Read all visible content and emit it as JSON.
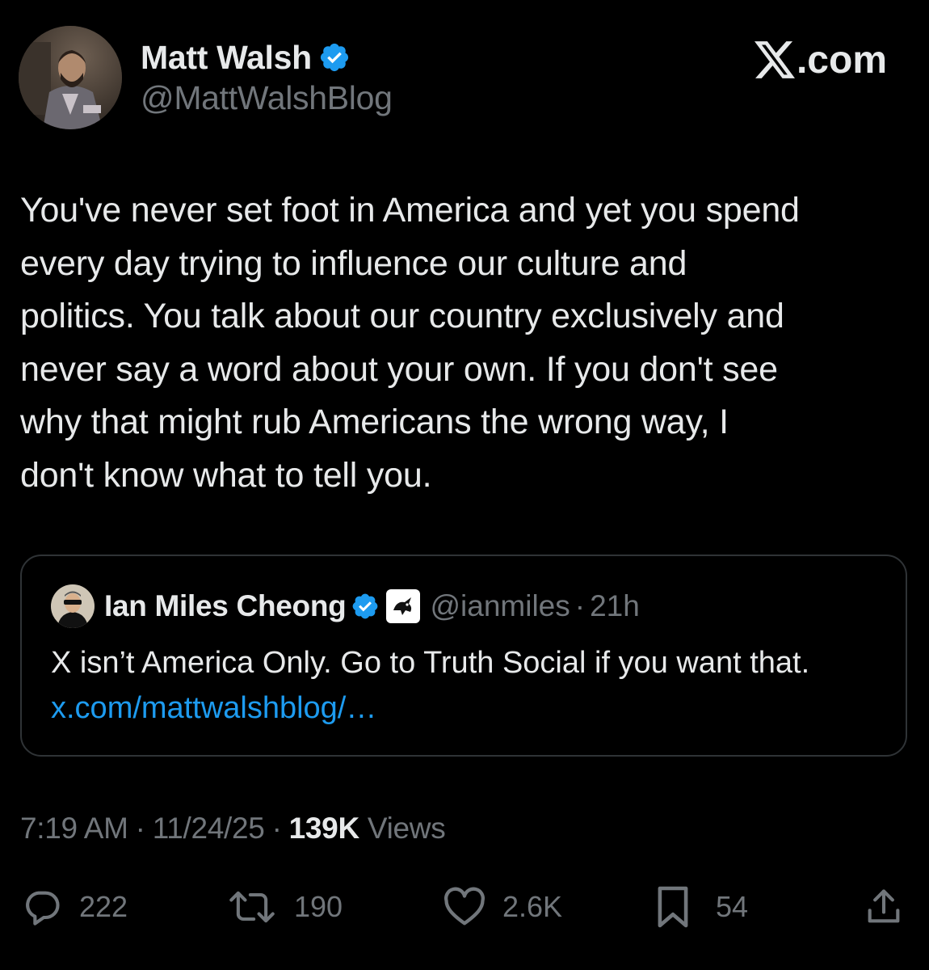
{
  "author": {
    "display_name": "Matt Walsh",
    "handle": "@MattWalshBlog",
    "verified": true
  },
  "brand": {
    "logo": "x-logo",
    "suffix": ".com"
  },
  "tweet": {
    "text": "You've never set foot in America and yet you spend\nevery day trying to influence our culture and\npolitics. You talk about our country exclusively and\nnever say a word about your own. If you don't see\nwhy that might rub Americans the wrong way, I\ndon't know what to tell you."
  },
  "quote": {
    "display_name": "Ian Miles Cheong",
    "handle": "@ianmiles",
    "time": "21h",
    "separator": "·",
    "text": "X isn’t America Only. Go to Truth Social if you want that.",
    "link": "x.com/mattwalshblog/…"
  },
  "meta": {
    "time": "7:19 AM",
    "date": "11/24/25",
    "separator": "·",
    "views_count": "139K",
    "views_label": "Views"
  },
  "actions": {
    "replies": "222",
    "reposts": "190",
    "likes": "2.6K",
    "bookmarks": "54"
  },
  "colors": {
    "background": "#000000",
    "text": "#e7e9ea",
    "secondary": "#71767b",
    "link": "#1d9bf0",
    "verified": "#1d9bf0",
    "border": "#2f3336"
  }
}
